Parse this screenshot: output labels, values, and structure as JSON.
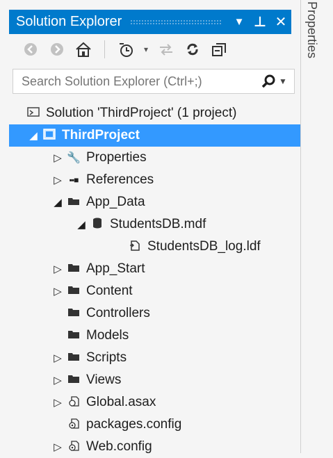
{
  "panel": {
    "title": "Solution Explorer",
    "dropdown_glyph": "▼",
    "pin_glyph": "⊥",
    "close_glyph": "✕"
  },
  "toolbar": {
    "icons": [
      "back-icon",
      "forward-icon",
      "home-icon",
      "pending-changes-icon",
      "sync-icon",
      "refresh-icon",
      "collapse-all-icon"
    ]
  },
  "search": {
    "placeholder": "Search Solution Explorer (Ctrl+;)",
    "value": ""
  },
  "tree": {
    "solution": "Solution 'ThirdProject' (1 project)",
    "project": "ThirdProject",
    "properties": "Properties",
    "references": "References",
    "app_data": "App_Data",
    "studentsdb": "StudentsDB.mdf",
    "studentsdb_log": "StudentsDB_log.ldf",
    "app_start": "App_Start",
    "content": "Content",
    "controllers": "Controllers",
    "models": "Models",
    "scripts": "Scripts",
    "views": "Views",
    "global": "Global.asax",
    "packages": "packages.config",
    "webconfig": "Web.config"
  },
  "side_tab": {
    "label": "Properties"
  },
  "colors": {
    "accent": "#007acc",
    "selection": "#3399ff"
  }
}
